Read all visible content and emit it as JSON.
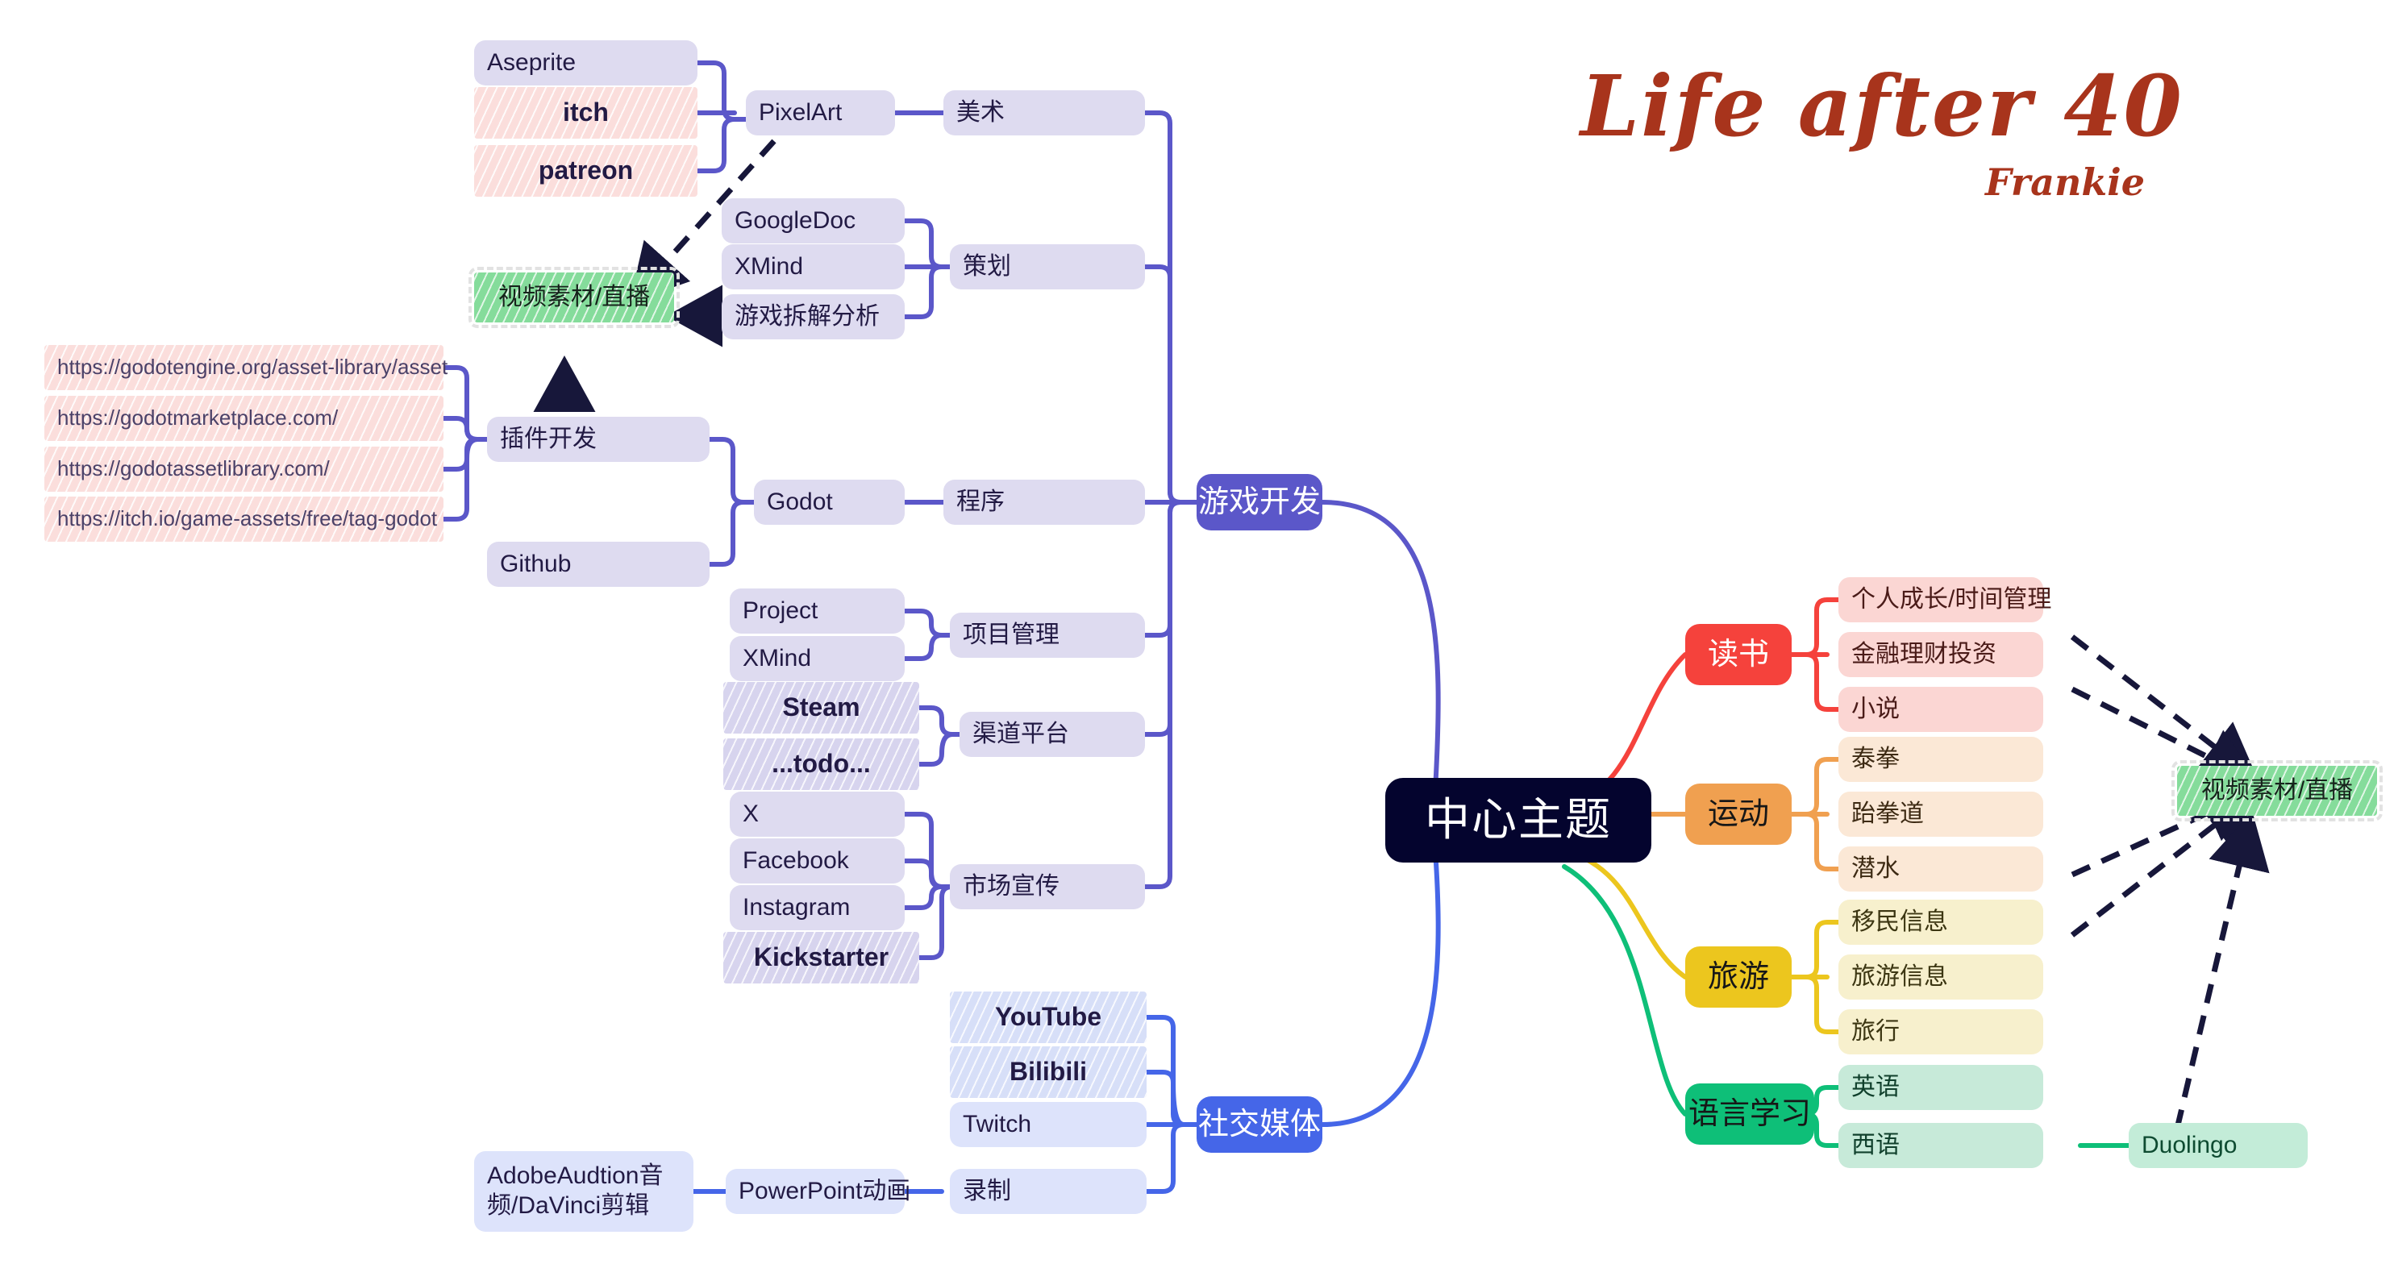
{
  "title": {
    "main": "Life after 40",
    "signature": "Frankie",
    "color": "#a8341c"
  },
  "center": {
    "label": "中心主题",
    "bg": "#04042e",
    "fg": "#ffffff"
  },
  "branches": {
    "gamedev": {
      "label": "游戏开发",
      "color": "#5b57c9"
    },
    "social": {
      "label": "社交媒体",
      "color": "#4566e8"
    },
    "reading": {
      "label": "读书",
      "color": "#f5423c"
    },
    "sport": {
      "label": "运动",
      "color": "#f0a050"
    },
    "travel": {
      "label": "旅游",
      "color": "#ecc61e"
    },
    "language": {
      "label": "语言学习",
      "color": "#0ebf78"
    }
  },
  "categories": {
    "art": "美术",
    "planning": "策划",
    "program": "程序",
    "project_mgmt": "项目管理",
    "channel": "渠道平台",
    "marketing": "市场宣传",
    "recording": "录制"
  },
  "leaves": {
    "aseprite": "Aseprite",
    "itch": "itch",
    "patreon": "patreon",
    "pixelart": "PixelArt",
    "googledoc": "GoogleDoc",
    "xmind_plan": "XMind",
    "game_analysis": "游戏拆解分析",
    "video_material_left": "视频素材/直播",
    "plugin_dev": "插件开发",
    "godot": "Godot",
    "github": "Github",
    "project": "Project",
    "xmind_pm": "XMind",
    "steam": "Steam",
    "todo": "...todo...",
    "x": "X",
    "facebook": "Facebook",
    "instagram": "Instagram",
    "kickstarter": "Kickstarter",
    "youtube": "YouTube",
    "bilibili": "Bilibili",
    "twitch": "Twitch",
    "powerpoint": "PowerPoint动画",
    "adobe_davinci": "AdobeAudtion音\n频/DaVinci剪辑"
  },
  "urls": [
    "https://godotengine.org/asset-library/asset",
    "https://godotmarketplace.com/",
    "https://godotassetlibrary.com/",
    "https://itch.io/game-assets/free/tag-godot"
  ],
  "reading_children": [
    "个人成长/时间管理",
    "金融理财投资",
    "小说"
  ],
  "sport_children": [
    "泰拳",
    "跆拳道",
    "潜水"
  ],
  "travel_children": [
    "移民信息",
    "旅游信息",
    "旅行"
  ],
  "language_children": [
    "英语",
    "西语"
  ],
  "duolingo": "Duolingo",
  "video_material_right": "视频素材/直播"
}
